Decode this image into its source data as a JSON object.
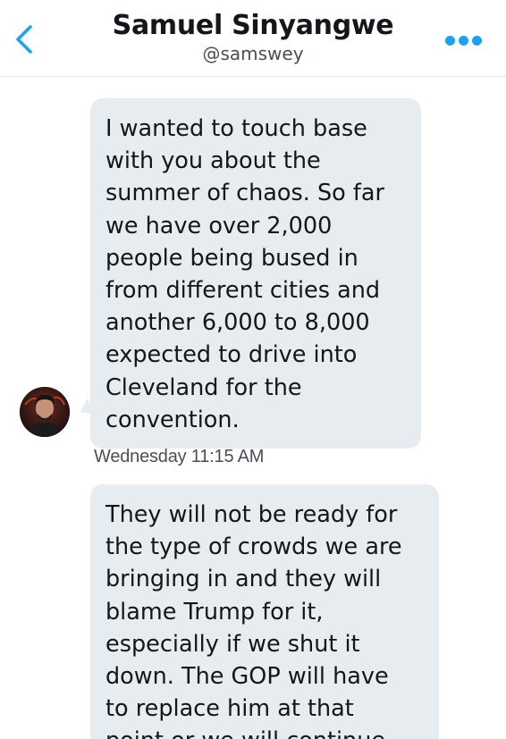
{
  "header": {
    "name": "Samuel Sinyangwe",
    "handle": "@samswey"
  },
  "messages": [
    {
      "text": "I wanted to touch base\nwith you about the\nsummer of chaos. So far\nwe have over 2,000\npeople being bused in\nfrom different cities and\nanother 6,000 to 8,000\nexpected to drive into\nCleveland for the\nconvention.",
      "timestamp": "Wednesday 11:15 AM"
    },
    {
      "text": "They will not be ready for\nthe type of crowds we are\nbringing in and they will\nblame Trump for it,\nespecially if we shut it\ndown. The GOP will have\nto replace him at that\npoint or we will continue"
    }
  ],
  "icons": {
    "back": "chevron-left-icon",
    "more": "more-horizontal-icon",
    "avatar": "user-avatar"
  },
  "colors": {
    "accent": "#1da1f2",
    "bubble": "#e6ecf0",
    "text": "#14171a",
    "secondary_text": "#4a4f55"
  }
}
